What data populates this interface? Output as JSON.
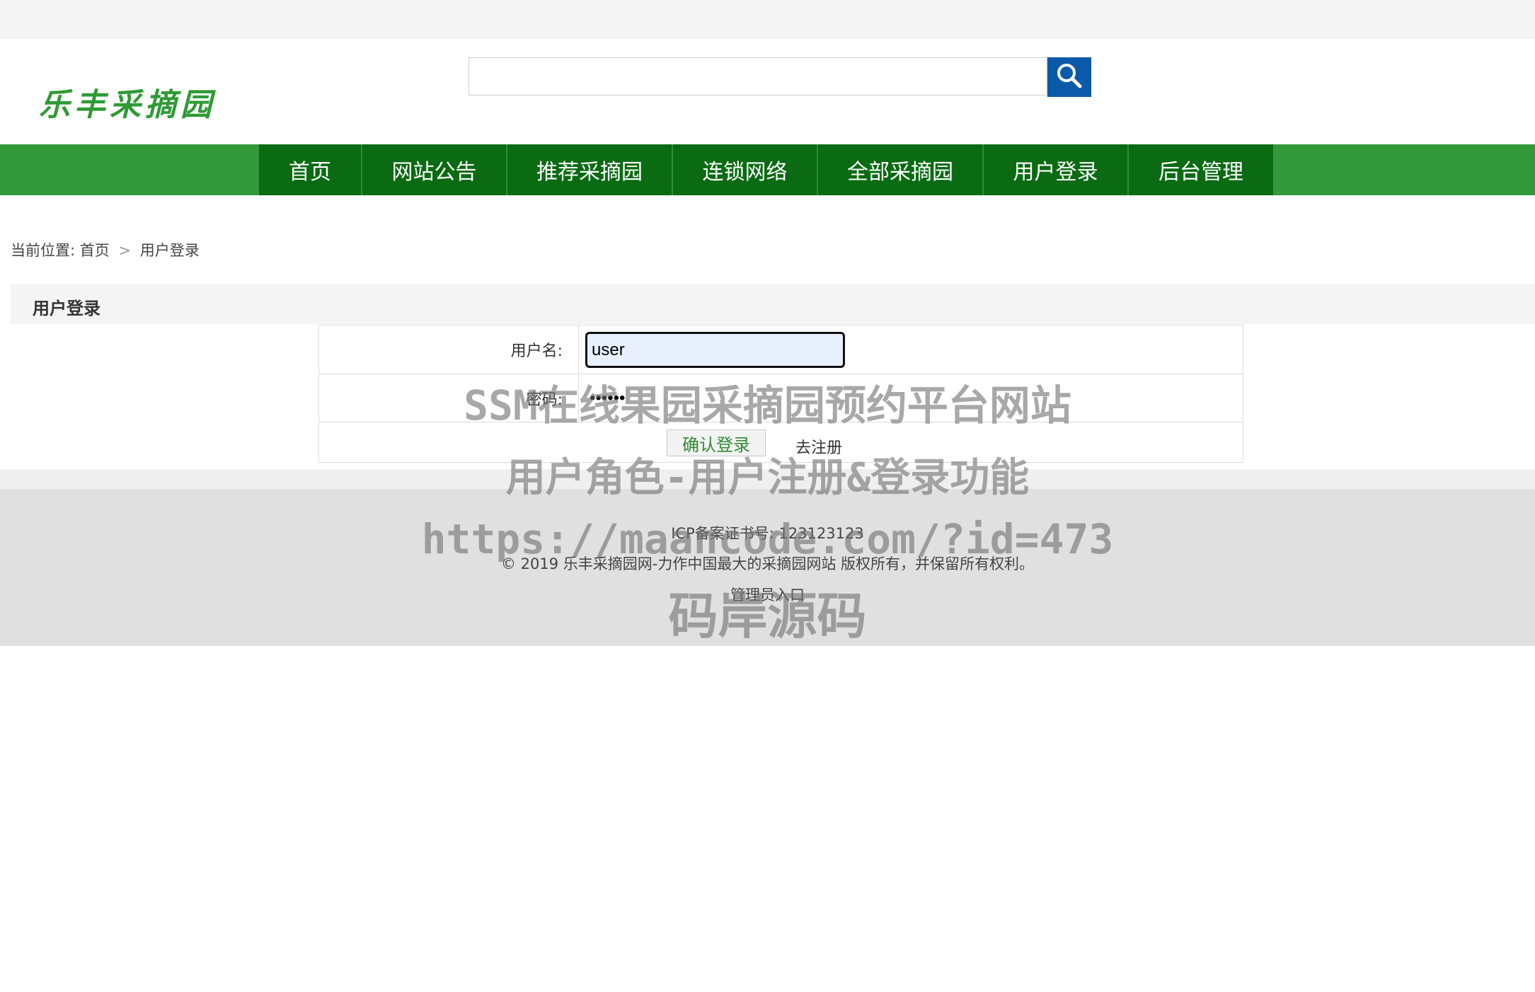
{
  "header": {
    "logo_text": "乐丰采摘园",
    "search": {
      "value": "",
      "placeholder": ""
    }
  },
  "nav": {
    "items": [
      "首页",
      "网站公告",
      "推荐采摘园",
      "连锁网络",
      "全部采摘园",
      "用户登录",
      "后台管理"
    ]
  },
  "breadcrumb": {
    "prefix": "当前位置:",
    "home": "首页",
    "current": "用户登录"
  },
  "panel": {
    "title": "用户登录"
  },
  "form": {
    "username_label": "用户名:",
    "username_value": "user",
    "password_label": "密码:",
    "password_value": "••••••",
    "confirm_label": "确认登录",
    "register_label": "去注册"
  },
  "footer": {
    "icp": "ICP备案证书号: 123123123",
    "copyright": "© 2019 乐丰采摘园网-力作中国最大的采摘园网站 版权所有，并保留所有权利。",
    "admin_link": "管理员入口"
  },
  "watermark": {
    "line1": "SSM在线果园采摘园预约平台网站",
    "line2": "用户角色-用户注册&登录功能",
    "line3": "https://maancode.com/?id=473",
    "line4": "码岸源码"
  },
  "colors": {
    "nav_bar": "#33993a",
    "nav_item": "#0a6b12",
    "logo": "#2f9a35",
    "search_button": "#0b5aaa",
    "confirm_text": "#2e8b32"
  }
}
